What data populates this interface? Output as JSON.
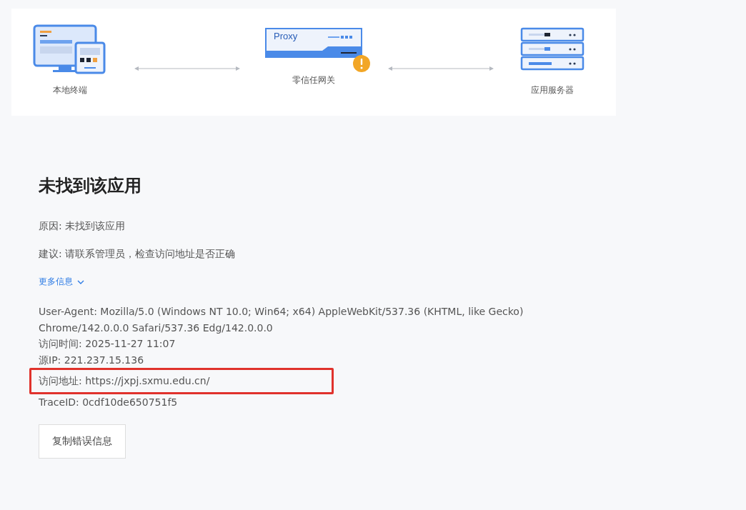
{
  "diagram": {
    "nodes": [
      {
        "kind": "terminal",
        "label": "本地终端"
      },
      {
        "kind": "proxy",
        "label": "零信任网关",
        "device_text": "Proxy",
        "warning": true
      },
      {
        "kind": "server",
        "label": "应用服务器"
      }
    ]
  },
  "error": {
    "title": "未找到该应用",
    "reason": "原因: 未找到该应用",
    "suggestion": "建议: 请联系管理员，检查访问地址是否正确",
    "more_info": {
      "label": "更多信息",
      "expanded": true
    },
    "details": [
      {
        "text": "User-Agent: Mozilla/5.0 (Windows NT 10.0; Win64; x64) AppleWebKit/537.36 (KHTML, like Gecko) Chrome/142.0.0.0 Safari/537.36 Edg/142.0.0.0",
        "highlighted": false
      },
      {
        "text": "访问时间: 2025-11-27 11:07",
        "highlighted": false
      },
      {
        "text": "源IP: 221.237.15.136",
        "highlighted": false
      },
      {
        "text": "访问地址: https://jxpj.sxmu.edu.cn/",
        "highlighted": true
      },
      {
        "text": "TraceID: 0cdf10de650751f5",
        "highlighted": false
      }
    ],
    "copy_button": "复制错误信息"
  }
}
